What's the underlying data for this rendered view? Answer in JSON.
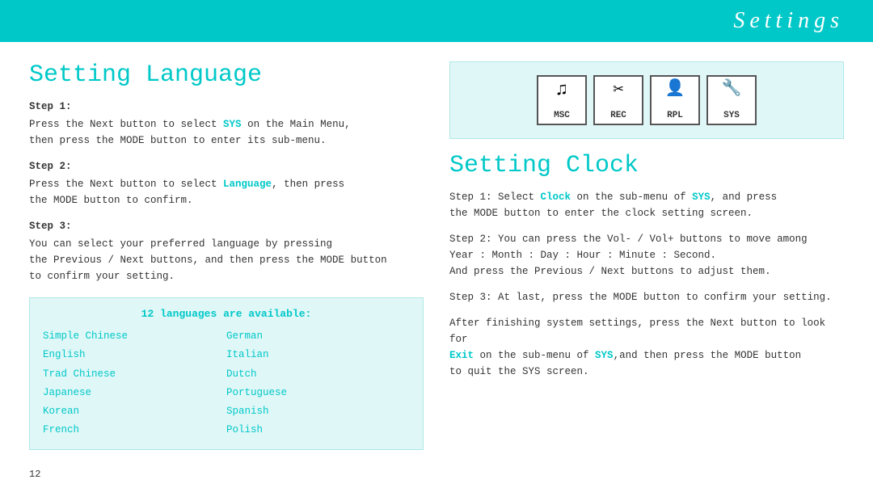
{
  "header": {
    "title": "Settings"
  },
  "left": {
    "section_title": "Setting Language",
    "steps": [
      {
        "label": "Step 1:",
        "text_before": "Press the Next button to select ",
        "highlight1": "SYS",
        "text_after1": " on the Main Menu,",
        "text_line2": "then press the MODE button to enter its sub-menu."
      },
      {
        "label": "Step 2:",
        "text_before": "Press the Next button to select ",
        "highlight1": "Language",
        "text_after1": ", then press",
        "text_line2": "the MODE button to confirm."
      },
      {
        "label": "Step 3:",
        "text": "You can select your preferred language by pressing the Previous / Next buttons, and then press the MODE button to confirm your setting."
      }
    ],
    "language_box": {
      "title": "12 languages are available:",
      "col1": [
        "Simple Chinese",
        "English",
        "Trad Chinese",
        "Japanese",
        "Korean",
        "French"
      ],
      "col2": [
        "German",
        "Italian",
        "Dutch",
        "Portuguese",
        "Spanish",
        "Polish"
      ]
    }
  },
  "right": {
    "icons": [
      {
        "symbol": "♫",
        "label": "MSC"
      },
      {
        "symbol": "✂",
        "label": "REC"
      },
      {
        "symbol": "▶",
        "label": "RPL"
      },
      {
        "symbol": "⚙",
        "label": "SYS"
      }
    ],
    "section_title": "Setting Clock",
    "steps": [
      {
        "label": "Step 1:",
        "text_before": "Select ",
        "highlight1": "Clock",
        "text_middle": " on the sub-menu of ",
        "highlight2": "SYS",
        "text_after": ", and press the MODE button to enter the clock setting screen."
      },
      {
        "label": "Step 2:",
        "text": "You can press the Vol- / Vol+ buttons to move among Year : Month : Day : Hour : Minute : Second. And press the Previous / Next buttons to adjust them."
      },
      {
        "label": "Step 3:",
        "text": "At last, press the MODE button to confirm your setting."
      },
      {
        "label": "",
        "text_before": "After finishing system settings, press the Next button to look for ",
        "highlight1": "Exit",
        "text_middle": " on the sub-menu of ",
        "highlight2": "SYS",
        "text_after": ",and then press the MODE button to quit the SYS screen."
      }
    ]
  },
  "page_number": "12"
}
